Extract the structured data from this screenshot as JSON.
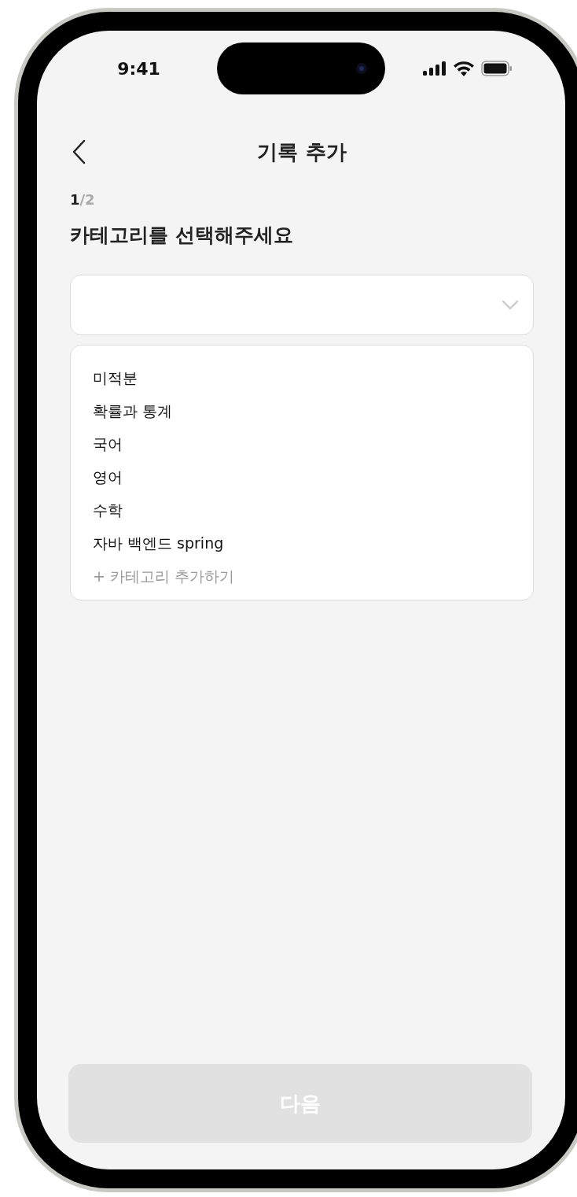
{
  "status_bar": {
    "time": "9:41"
  },
  "header": {
    "title": "기록 추가"
  },
  "step": {
    "current": "1",
    "total": "/2"
  },
  "prompt": "카테고리를 선택해주세요",
  "dropdown": {
    "expanded": true
  },
  "options": [
    {
      "label": "미적분",
      "kind": "option"
    },
    {
      "label": "확률과 통계",
      "kind": "option"
    },
    {
      "label": "국어",
      "kind": "option"
    },
    {
      "label": "영어",
      "kind": "option"
    },
    {
      "label": "수학",
      "kind": "option"
    },
    {
      "label": "자바 백엔드 spring",
      "kind": "option"
    },
    {
      "label": "+ 카테고리 추가하기",
      "kind": "add"
    }
  ],
  "next_button": {
    "label": "다음",
    "disabled": true
  }
}
